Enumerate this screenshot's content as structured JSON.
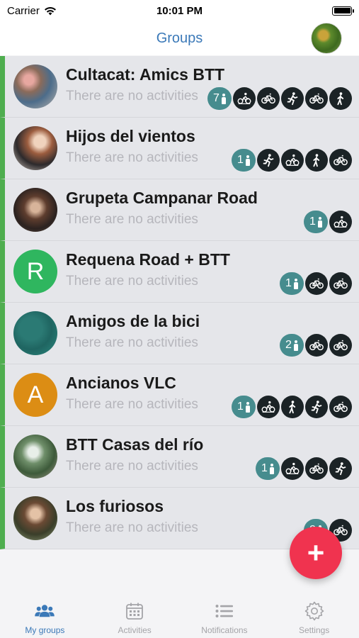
{
  "status": {
    "carrier": "Carrier",
    "time": "10:01 PM"
  },
  "nav": {
    "title": "Groups"
  },
  "colors": {
    "accent": "#3b79b8",
    "row_stripe": "#4fae4f",
    "badge_teal": "#468c8e",
    "icon_dark": "#1b2326",
    "fab": "#f0334f"
  },
  "groups": [
    {
      "name": "Cultacat: Amics BTT",
      "status": "There are no activities",
      "members": "7",
      "avatar": "photo",
      "activities": [
        "cycling-icon",
        "bike-icon",
        "running-icon",
        "bike-icon",
        "walking-icon"
      ]
    },
    {
      "name": "Hijos del vientos",
      "status": "There are no activities",
      "members": "1",
      "avatar": "photo",
      "activities": [
        "running-icon",
        "cycling-icon",
        "walking-icon",
        "bike-icon"
      ]
    },
    {
      "name": "Grupeta Campanar Road",
      "status": "There are no activities",
      "members": "1",
      "avatar": "photo",
      "activities": [
        "cycling-icon"
      ]
    },
    {
      "name": "Requena Road + BTT",
      "status": "There are no activities",
      "members": "1",
      "avatar": "R",
      "avatar_color": "#2fb65f",
      "activities": [
        "bike-icon",
        "bike-icon"
      ]
    },
    {
      "name": "Amigos de la bici",
      "status": "There are no activities",
      "members": "2",
      "avatar": "map",
      "activities": [
        "bike-icon",
        "bike-icon"
      ]
    },
    {
      "name": "Ancianos VLC",
      "status": "There are no activities",
      "members": "1",
      "avatar": "A",
      "avatar_color": "#dc8d14",
      "activities": [
        "cycling-icon",
        "walking-icon",
        "running-icon",
        "bike-icon"
      ]
    },
    {
      "name": "BTT Casas del río",
      "status": "There are no activities",
      "members": "1",
      "avatar": "photo",
      "activities": [
        "cycling-icon",
        "bike-icon",
        "running-icon"
      ]
    },
    {
      "name": "Los furiosos",
      "status": "There are no activities",
      "members": "2",
      "avatar": "photo",
      "activities": [
        "bike-icon"
      ]
    }
  ],
  "tabs": [
    {
      "label": "My groups",
      "icon": "group-icon",
      "active": true
    },
    {
      "label": "Activities",
      "icon": "calendar-icon",
      "active": false
    },
    {
      "label": "Notifications",
      "icon": "list-icon",
      "active": false
    },
    {
      "label": "Settings",
      "icon": "gear-icon",
      "active": false
    }
  ],
  "fab": {
    "label": "+"
  }
}
